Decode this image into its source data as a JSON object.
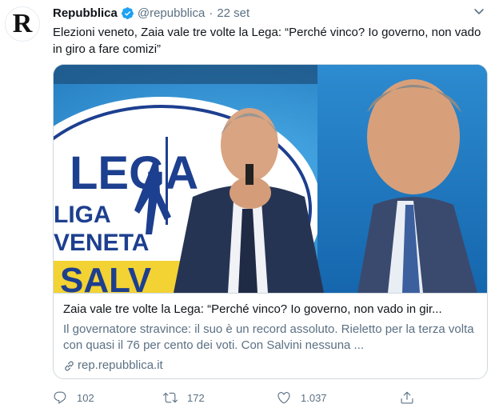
{
  "tweet": {
    "avatar_letter": "R",
    "display_name": "Repubblica",
    "verified_icon": "verified-badge-icon",
    "handle": "@repubblica",
    "separator": "·",
    "date": "22 set",
    "text": "Elezioni veneto, Zaia vale tre volte la Lega: “Perché vinco? Io governo, non vado in giro a fare comizi”"
  },
  "card": {
    "image_text": {
      "logo_top": "LEGA",
      "logo_line1": "LIGA",
      "logo_line2": "VENETA",
      "logo_bottom": "SALV"
    },
    "title": "Zaia vale tre volte la Lega: “Perché vinco? Io governo, non vado in gir...",
    "description": "Il governatore stravince: il suo è un record assoluto. Rieletto per la terza volta con quasi il 76 per cento dei voti. Con Salvini nessuna ...",
    "domain": "rep.repubblica.it"
  },
  "actions": {
    "reply_count": "102",
    "retweet_count": "172",
    "like_count": "1.037"
  },
  "colors": {
    "text": "#0f1419",
    "secondary": "#5b7083",
    "border": "#cfd9de",
    "verified": "#1da1f2"
  }
}
